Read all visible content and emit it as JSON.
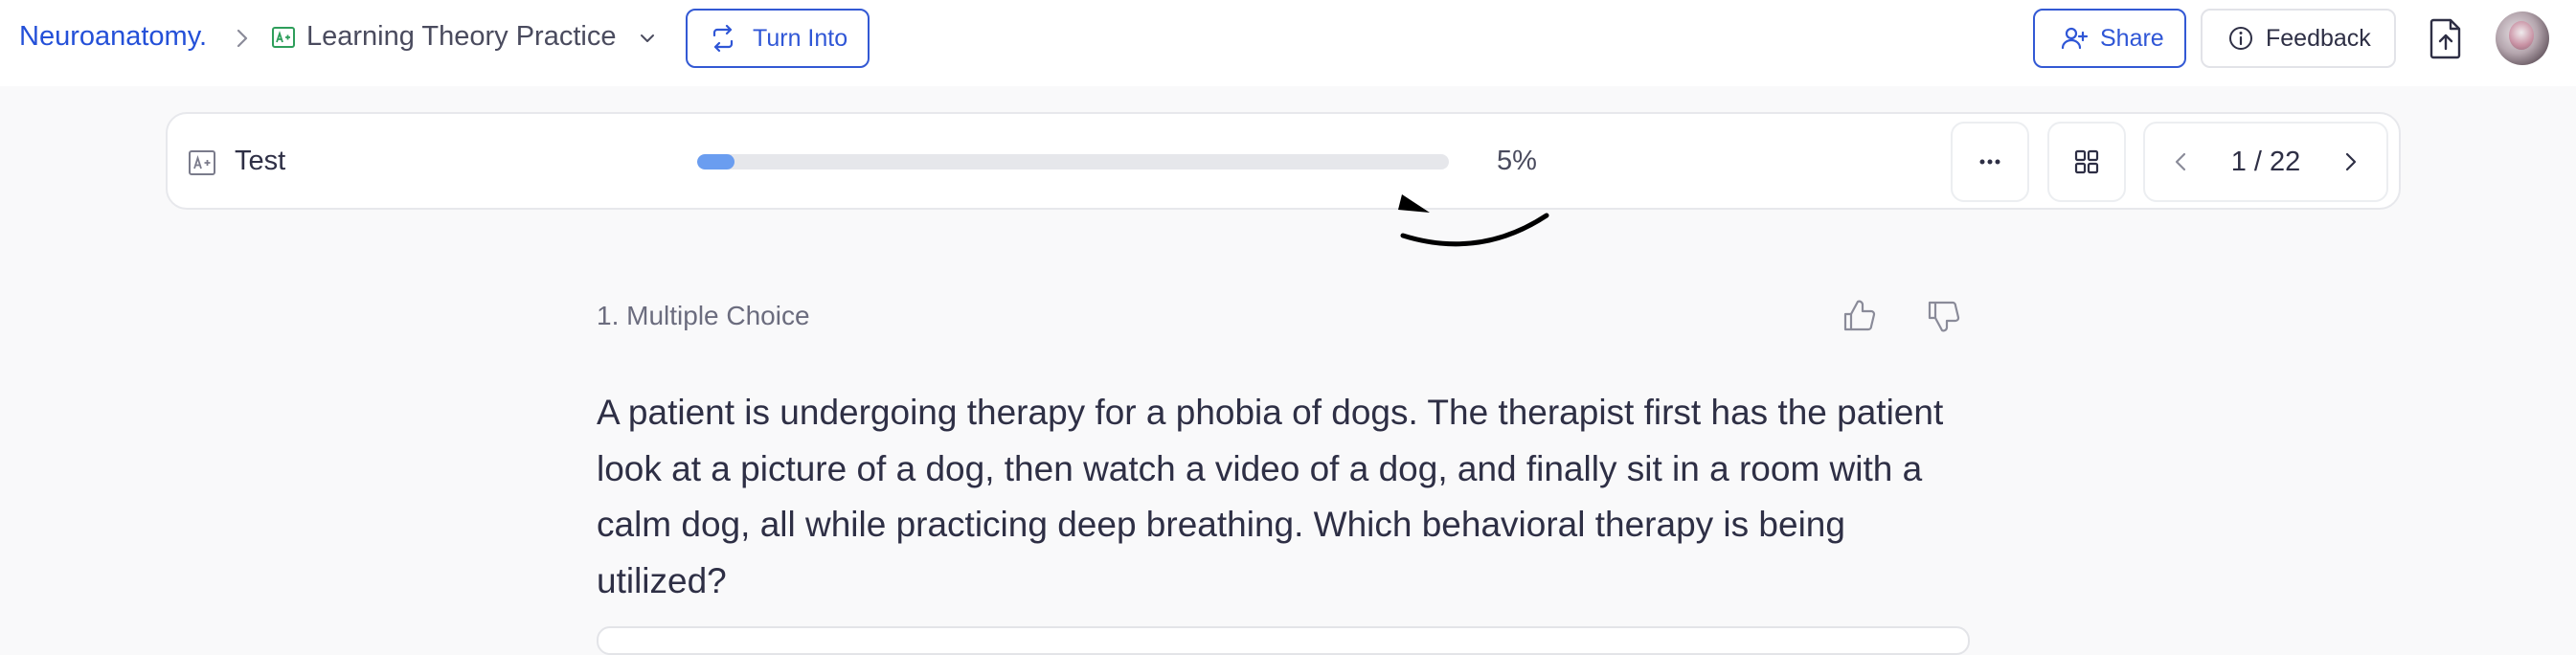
{
  "header": {
    "breadcrumb_root": "Neuroanatomy.",
    "doc_title": "Learning Theory Practice",
    "turn_into_label": "Turn Into",
    "share_label": "Share",
    "feedback_label": "Feedback"
  },
  "icons": {
    "breadcrumb_sep": "chevron-right-icon",
    "doc": "flashcard-doc-icon",
    "title_dropdown": "chevron-down-icon",
    "turn_into": "convert-icon",
    "share": "add-user-icon",
    "feedback": "info-icon",
    "export": "file-upload-icon",
    "more": "more-horizontal-icon",
    "grid": "grid-icon",
    "prev": "chevron-left-icon",
    "next": "chevron-right-icon",
    "thumbs_up": "thumbs-up-icon",
    "thumbs_down": "thumbs-down-icon"
  },
  "test_bar": {
    "title": "Test",
    "progress_fraction": 0.05,
    "progress_label": "5%",
    "pager_label": "1 / 22"
  },
  "question": {
    "type_label": "1. Multiple Choice",
    "text": "A patient is undergoing therapy for a phobia of dogs. The therapist first has the patient look at a picture of a dog, then watch a video of a dog, and finally sit in a room with a calm dog, all while practicing deep breathing. Which behavioral therapy is being utilized?"
  },
  "colors": {
    "accent": "#2f56d6",
    "progress_fill": "#6a9df0",
    "progress_track": "#e6e7eb",
    "page_background": "#f9f9fa"
  }
}
